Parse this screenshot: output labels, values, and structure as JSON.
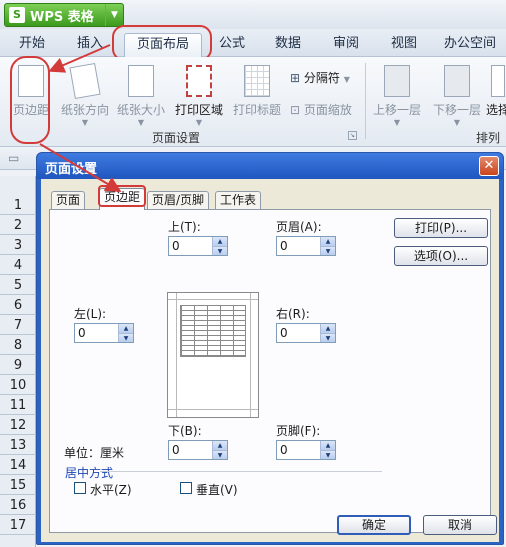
{
  "app": {
    "title": "WPS 表格",
    "logo_letter": "S"
  },
  "tabs": [
    "开始",
    "插入",
    "页面布局",
    "公式",
    "数据",
    "审阅",
    "视图",
    "办公空间"
  ],
  "ribbon": {
    "margins": "页边距",
    "orientation": "纸张方向",
    "size": "纸张大小",
    "print_area": "打印区域",
    "print_titles": "打印标题",
    "separator": "分隔符",
    "page_zoom": "页面缩放",
    "bring_forward": "上移一层",
    "send_backward": "下移一层",
    "select": "选择",
    "group_page_setup": "页面设置",
    "group_arrange": "排列"
  },
  "row_numbers": [
    "1",
    "2",
    "3",
    "4",
    "5",
    "6",
    "7",
    "8",
    "9",
    "10",
    "11",
    "12",
    "13",
    "14",
    "15",
    "16",
    "17"
  ],
  "dialog": {
    "title": "页面设置",
    "tabs": [
      "页面",
      "页边距",
      "页眉/页脚",
      "工作表"
    ],
    "top_label": "上(T):",
    "top_value": "0",
    "header_label": "页眉(A):",
    "header_value": "0",
    "left_label": "左(L):",
    "left_value": "0",
    "right_label": "右(R):",
    "right_value": "0",
    "bottom_label": "下(B):",
    "bottom_value": "0",
    "footer_label": "页脚(F):",
    "footer_value": "0",
    "unit_label": "单位：厘米",
    "center_group": "居中方式",
    "horizontal": "水平(Z)",
    "vertical": "垂直(V)",
    "print_button": "打印(P)...",
    "options_button": "选项(O)...",
    "ok_button": "确定",
    "cancel_button": "取消",
    "close_glyph": "✕"
  },
  "colors": {
    "annotation": "#d33b3b",
    "dialog_title": "#1f56bf",
    "group_title": "#1f46b3"
  }
}
